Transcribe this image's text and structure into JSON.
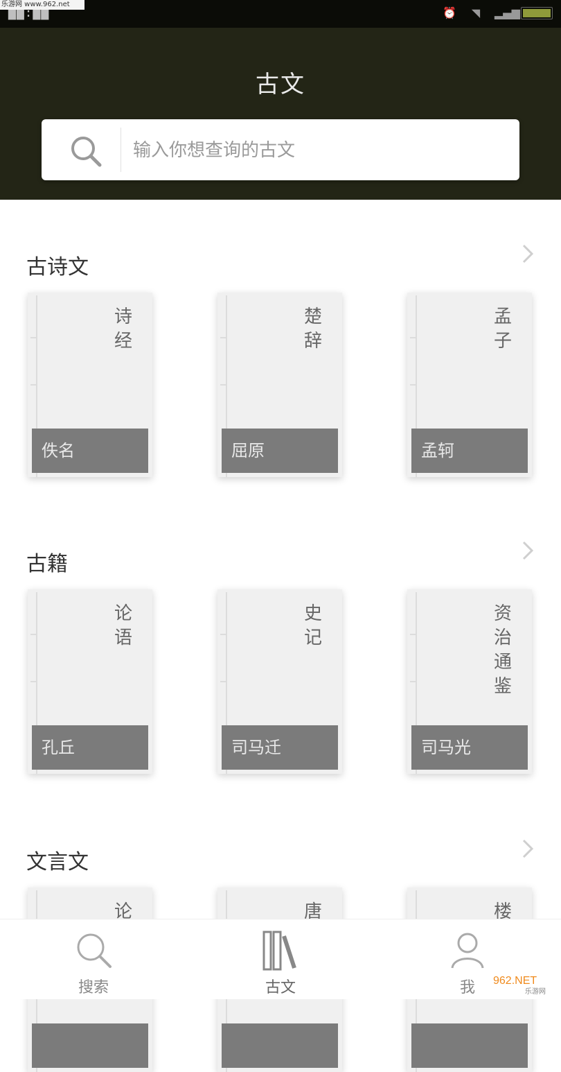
{
  "status_bar": {
    "time": "██:██"
  },
  "watermark": {
    "top_text": "乐游网 www.962.net",
    "logo_text": "962.NET",
    "logo_sub": "乐游网"
  },
  "header": {
    "title": "古文"
  },
  "search": {
    "placeholder": "输入你想查询的古文",
    "value": ""
  },
  "sections": [
    {
      "title": "古诗文",
      "books": [
        {
          "title": "诗经",
          "author": "佚名"
        },
        {
          "title": "楚辞",
          "author": "屈原"
        },
        {
          "title": "孟子",
          "author": "孟轲"
        }
      ]
    },
    {
      "title": "古籍",
      "books": [
        {
          "title": "论语",
          "author": "孔丘"
        },
        {
          "title": "史记",
          "author": "司马迁"
        },
        {
          "title": "资治通鉴",
          "author": "司马光"
        }
      ]
    },
    {
      "title": "文言文",
      "books": [
        {
          "title": "论",
          "author": ""
        },
        {
          "title": "唐",
          "author": ""
        },
        {
          "title": "楼",
          "author": ""
        }
      ]
    }
  ],
  "tabs": [
    {
      "label": "搜索",
      "icon": "search-icon"
    },
    {
      "label": "古文",
      "icon": "books-icon",
      "active": true
    },
    {
      "label": "我",
      "icon": "user-icon"
    }
  ],
  "colors": {
    "header_bg": "#232516",
    "author_bar": "#7b7b7b",
    "book_bg": "#f0f0f0"
  }
}
